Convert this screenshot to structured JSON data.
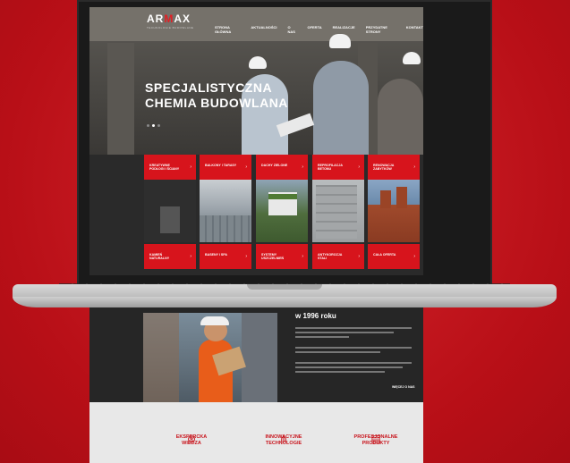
{
  "brand": {
    "logo_prefix": "AR",
    "logo_x": "M",
    "logo_suffix": "AX",
    "tagline": "TECHNOLOGIE BUDOWLANE"
  },
  "nav": {
    "items": [
      "STRONA GŁÓWNA",
      "AKTUALNOŚCI",
      "O NAS",
      "OFERTA",
      "REALIZACJE",
      "PRZYDATNE STRONY",
      "KONTAKT"
    ]
  },
  "hero": {
    "title_line1": "SPECJALISTYCZNA",
    "title_line2": "CHEMIA BUDOWLANA",
    "slides": 3,
    "active_slide": 2
  },
  "tiles_top": [
    {
      "line1": "KREATYWNE",
      "line2": "PODŁOGI I ŚCIANY"
    },
    {
      "line1": "BALKONY I TARASY",
      "line2": ""
    },
    {
      "line1": "DACHY ZIELONE",
      "line2": ""
    },
    {
      "line1": "REPROFILACJA",
      "line2": "BETONU"
    },
    {
      "line1": "RENOWACJA",
      "line2": "ZABYTKÓW"
    }
  ],
  "tiles_bottom": [
    {
      "line1": "KAMIEŃ",
      "line2": "NATURALNY"
    },
    {
      "line1": "BASENY I SPA",
      "line2": ""
    },
    {
      "line1": "SYSTEMY",
      "line2": "USZCZELNIEŃ"
    },
    {
      "line1": "ANTYKOROZJA",
      "line2": "STALI"
    },
    {
      "line1": "CAŁA OFERTA",
      "line2": ""
    }
  ],
  "about": {
    "year_text": "w 1996 roku",
    "more_link": "WIĘCEJ O NAS"
  },
  "features": [
    {
      "line1": "EKSPERCKA",
      "line2": "WIEDZA",
      "icon": "brain-icon"
    },
    {
      "line1": "INNOWACYJNE",
      "line2": "TECHNOLOGIE",
      "icon": "network-icon"
    },
    {
      "line1": "PROFESJONALNE",
      "line2": "PRODUKTY",
      "icon": "clipboard-icon"
    }
  ],
  "colors": {
    "brand_red": "#d7141c",
    "background_red": "#c8141c",
    "dark": "#262626"
  }
}
